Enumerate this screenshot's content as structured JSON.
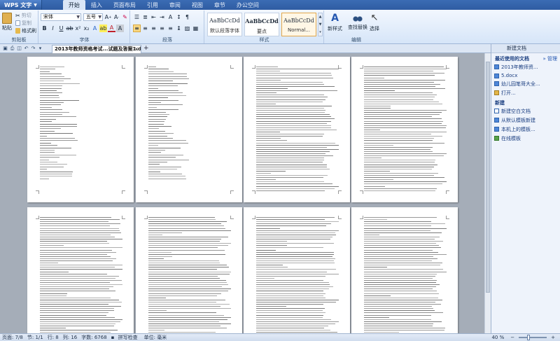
{
  "app": {
    "logo": "WPS 文字"
  },
  "menu": [
    "开始",
    "插入",
    "页面布局",
    "引用",
    "审阅",
    "视图",
    "章节",
    "办公空间"
  ],
  "ribbon": {
    "paste": "粘贴",
    "cut": "剪切",
    "copy": "复制",
    "format_painter": "格式刷",
    "font_name": "宋体",
    "font_size": "五号",
    "styles": [
      {
        "preview": "AaBbCcDd",
        "name": "默认段落字体"
      },
      {
        "preview": "AaBbCcDd",
        "name": "要点"
      },
      {
        "preview": "AaBbCcDd",
        "name": "Normal..."
      }
    ],
    "new_style": "新样式",
    "find_replace": "查找替换",
    "select": "选择",
    "groups": {
      "clipboard": "剪贴板",
      "font": "字体",
      "paragraph": "段落",
      "styles": "样式",
      "edit": "编辑"
    }
  },
  "doc_tab": {
    "title": "2013年教师资格考试...试题及答案1.docx"
  },
  "pane": {
    "title": "新建文档",
    "recent_heading": "最近使用的文档",
    "manage": "» 管理",
    "recent": [
      "2013年教师资...",
      "5.docx",
      "幼儿园笔哥大全...",
      "打开..."
    ],
    "new_heading": "新建",
    "new_items": [
      "新建空白文档",
      "从默认模板新建",
      "本机上的模板...",
      "在线模板"
    ]
  },
  "status": {
    "page": "页面: 7/8",
    "section": "节: 1/1",
    "row": "行: 8",
    "col": "列: 16",
    "words": "字数: 6768",
    "spell": "拼写检查",
    "unit": "单位: 毫米",
    "zoom": "40 %"
  },
  "colors": {
    "accent": "#2f5ca2",
    "ribbon": "#dbe7f6",
    "workspace": "#a5adb8"
  }
}
